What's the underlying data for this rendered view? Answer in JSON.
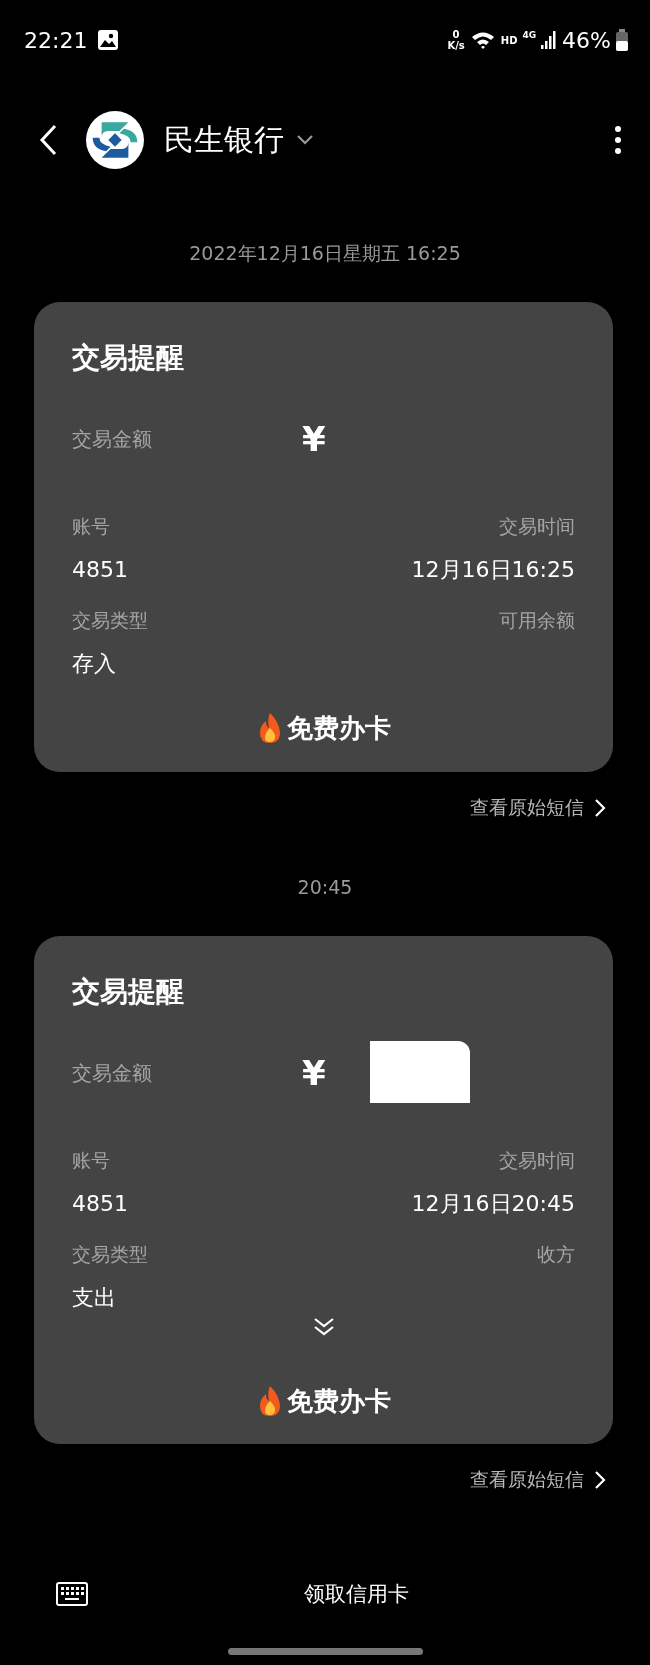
{
  "status_bar": {
    "time": "22:21",
    "net_speed": [
      "0",
      "K/s"
    ],
    "hd": "HD",
    "network": "4G",
    "battery": "46%"
  },
  "header": {
    "title": "民生银行"
  },
  "messages": [
    {
      "timestamp": "2022年12月16日星期五 16:25",
      "card": {
        "title": "交易提醒",
        "amount_label": "交易金额",
        "amount": "¥",
        "redaction_mark": false,
        "fields": [
          {
            "label": "账号",
            "value": "4851"
          },
          {
            "label": "交易时间",
            "value": "12月16日16:25"
          },
          {
            "label": "交易类型",
            "value": "存入"
          },
          {
            "label": "可用余额"
          }
        ],
        "expandable": false,
        "action": "免费办卡"
      },
      "link": "查看原始短信"
    },
    {
      "timestamp": "20:45",
      "card": {
        "title": "交易提醒",
        "amount_label": "交易金额",
        "amount": "¥",
        "redaction_mark": true,
        "fields": [
          {
            "label": "账号",
            "value": "4851"
          },
          {
            "label": "交易时间",
            "value": "12月16日20:45"
          },
          {
            "label": "交易类型",
            "value": "支出"
          },
          {
            "label": "收方"
          }
        ],
        "expandable": true,
        "action": "免费办卡"
      },
      "link": "查看原始短信"
    }
  ],
  "bottom_bar": {
    "button": "领取信用卡"
  }
}
